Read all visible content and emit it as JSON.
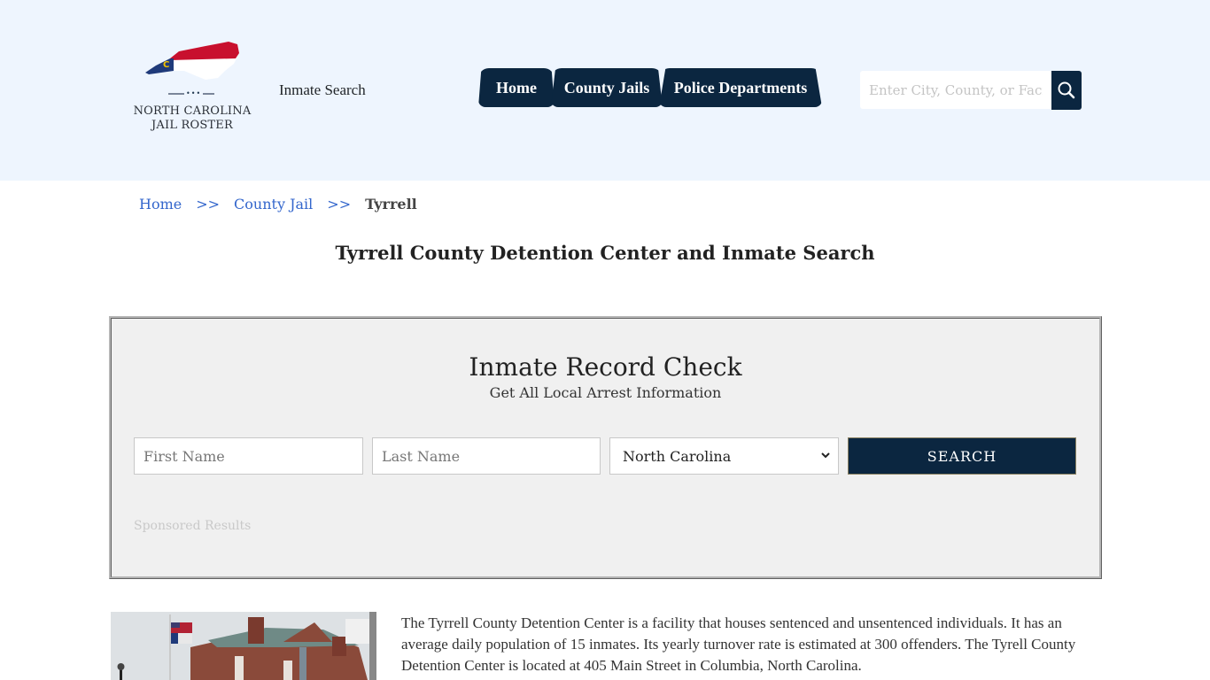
{
  "header": {
    "logo": {
      "line1": "NORTH CAROLINA",
      "line2": "JAIL ROSTER",
      "dots": "•••"
    },
    "inmate_search_link": "Inmate Search",
    "nav": [
      {
        "label": "Home"
      },
      {
        "label": "County Jails"
      },
      {
        "label": "Police Departments"
      }
    ],
    "search": {
      "placeholder": "Enter City, County, or Facility",
      "value": ""
    }
  },
  "breadcrumb": {
    "items": [
      {
        "label": "Home"
      },
      {
        "label": "County Jail"
      }
    ],
    "separator": ">>",
    "current": "Tyrrell"
  },
  "page_title": "Tyrrell County Detention Center and Inmate Search",
  "record_check": {
    "title": "Inmate Record Check",
    "subtitle": "Get All Local Arrest Information",
    "first_name_placeholder": "First Name",
    "last_name_placeholder": "Last Name",
    "state_selected": "North Carolina",
    "search_label": "SEARCH",
    "sponsored": "Sponsored Results"
  },
  "description": "The Tyrrell County Detention Center is a facility that houses sentenced and unsentenced individuals. It has an average daily population of 15 inmates. Its yearly turnover rate is estimated at 300 offenders. The Tyrell County Detention Center is located at 405 Main Street in Columbia, North Carolina.",
  "colors": {
    "header_bg": "#eef5fe",
    "navy": "#0b2640",
    "link_blue": "#3366cc",
    "box_bg": "#f0f0f0"
  }
}
